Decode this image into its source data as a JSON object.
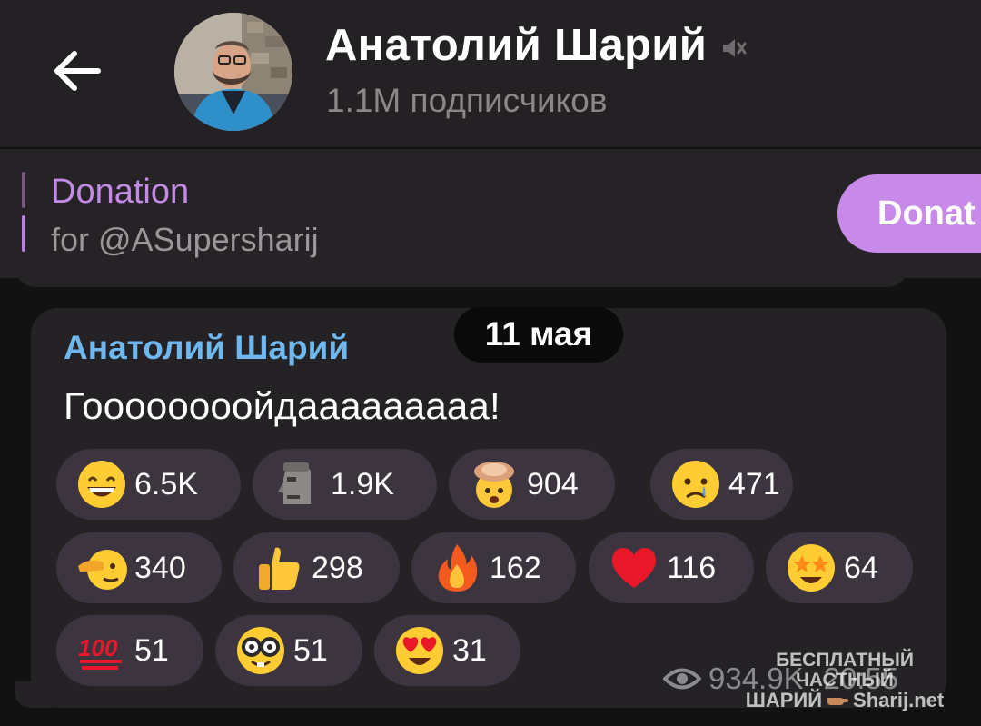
{
  "header": {
    "back_icon": "arrow-left-icon",
    "channel_title": "Анатолий Шарий",
    "mute_icon": "muted-speaker-icon",
    "subscribers": "1.1M подписчиков"
  },
  "pinned": {
    "title": "Donation",
    "subtitle": "for @ASupersharij",
    "button_label": "Donat"
  },
  "message": {
    "date": "11 мая",
    "sender": "Анатолий Шарий",
    "text": "Гоооооооойдааааааааа!",
    "views": "934.9K",
    "time": "20:55",
    "views_icon": "eye-icon",
    "reactions": [
      {
        "emoji": "grinning-face",
        "count": "6.5K"
      },
      {
        "emoji": "moai-statue",
        "count": "1.9K"
      },
      {
        "emoji": "exploding-head",
        "count": "904"
      },
      {
        "emoji": "crying-face",
        "count": "471"
      },
      {
        "emoji": "saluting-face",
        "count": "340"
      },
      {
        "emoji": "thumbs-up",
        "count": "298"
      },
      {
        "emoji": "fire",
        "count": "162"
      },
      {
        "emoji": "red-heart",
        "count": "116"
      },
      {
        "emoji": "star-struck",
        "count": "64"
      },
      {
        "emoji": "hundred-points",
        "count": "51"
      },
      {
        "emoji": "nerd-face",
        "count": "51"
      },
      {
        "emoji": "heart-eyes",
        "count": "31"
      }
    ]
  },
  "watermark": {
    "line1": "БЕСПЛАТНЫЙ ЧАСТНЫЙ",
    "line2": "ШАРИЙ",
    "line3": "Sharij.net"
  },
  "colors": {
    "header_bg": "#242124",
    "accent_purple": "#c88ae8",
    "sender_blue": "#6fb7ef",
    "reaction_bg": "#3c343f"
  }
}
